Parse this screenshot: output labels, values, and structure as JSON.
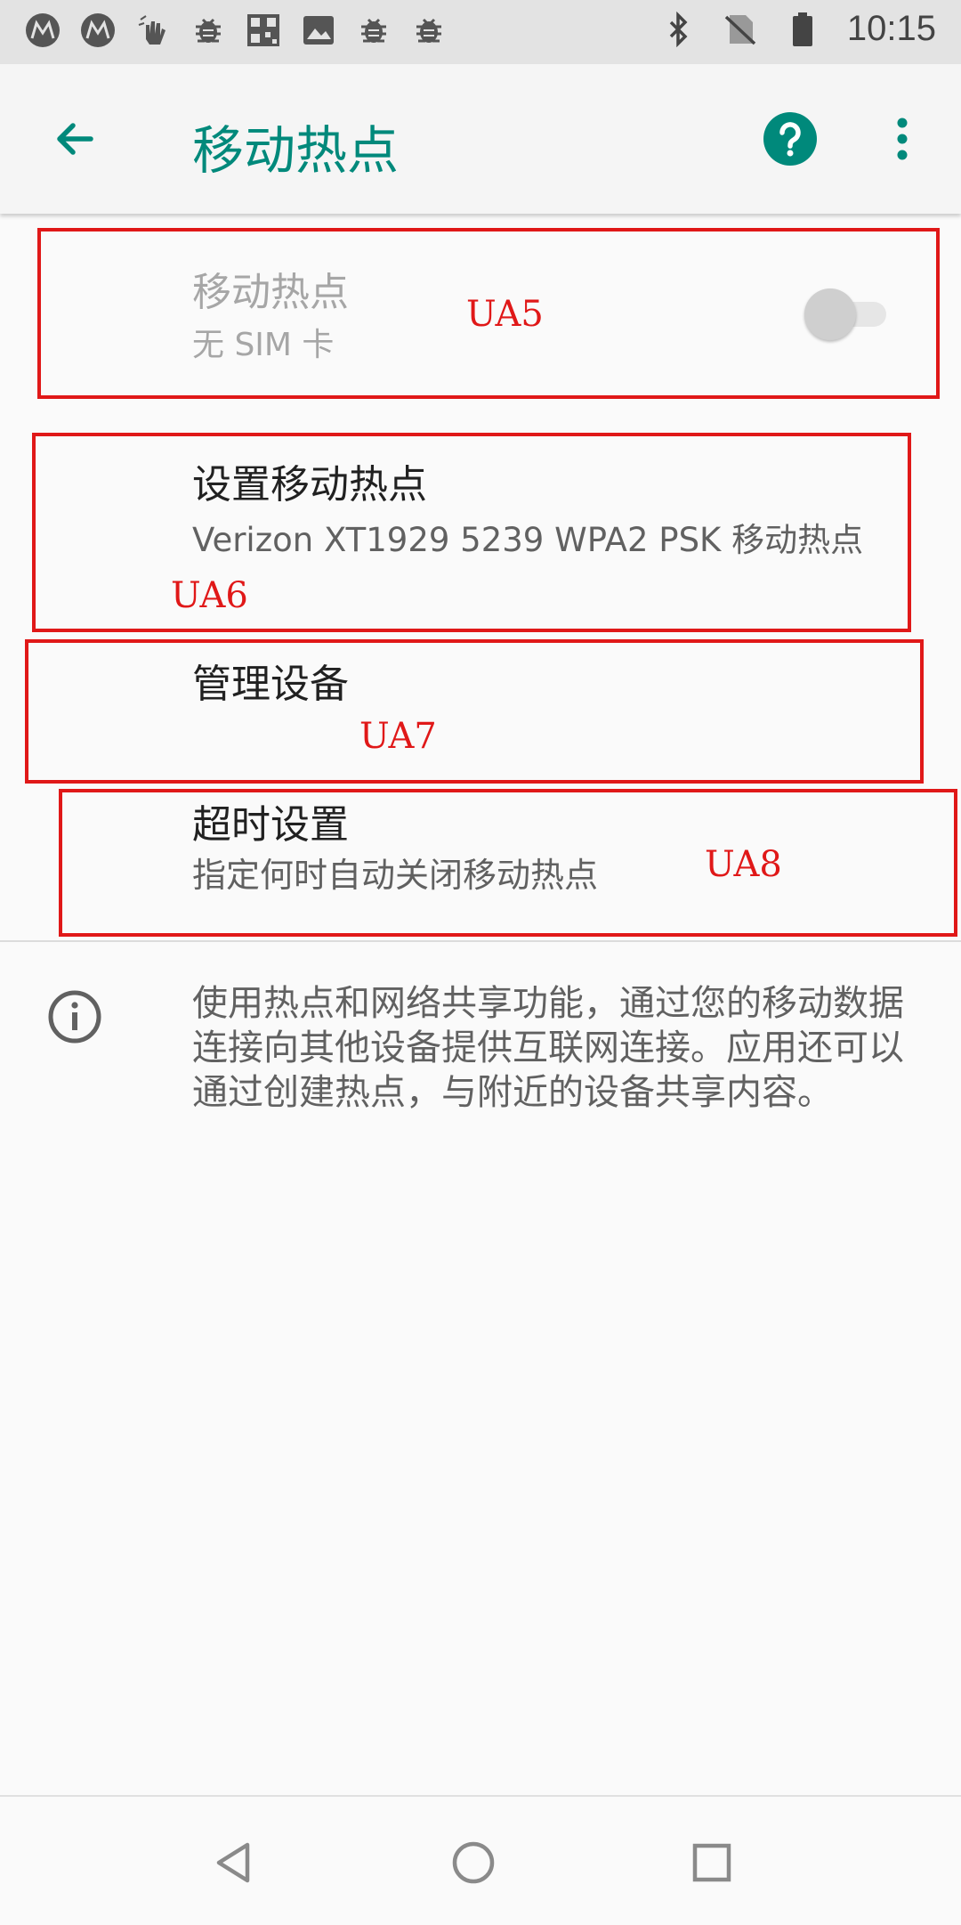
{
  "status_bar": {
    "time": "10:15",
    "left_icons": [
      "motorola-icon",
      "motorola-icon",
      "gesture-icon",
      "bug-icon",
      "qr-code-icon",
      "image-icon",
      "bug-icon",
      "bug-icon"
    ],
    "right_icons": [
      "bluetooth-icon",
      "no-sim-icon",
      "battery-icon"
    ]
  },
  "app_bar": {
    "title": "移动热点"
  },
  "settings": {
    "hotspot_toggle": {
      "title": "移动热点",
      "subtitle": "无 SIM 卡",
      "enabled": false,
      "checked": false,
      "annotation": "UA5"
    },
    "setup": {
      "title": "设置移动热点",
      "subtitle": "Verizon XT1929 5239 WPA2 PSK 移动热点",
      "annotation": "UA6"
    },
    "manage_devices": {
      "title": "管理设备",
      "annotation": "UA7"
    },
    "timeout": {
      "title": "超时设置",
      "subtitle": "指定何时自动关闭移动热点",
      "annotation": "UA8"
    }
  },
  "info": {
    "text": "使用热点和网络共享功能，通过您的移动数据连接向其他设备提供互联网连接。应用还可以通过创建热点，与附近的设备共享内容。"
  },
  "colors": {
    "accent": "#00897b",
    "annotation": "#e01818"
  }
}
